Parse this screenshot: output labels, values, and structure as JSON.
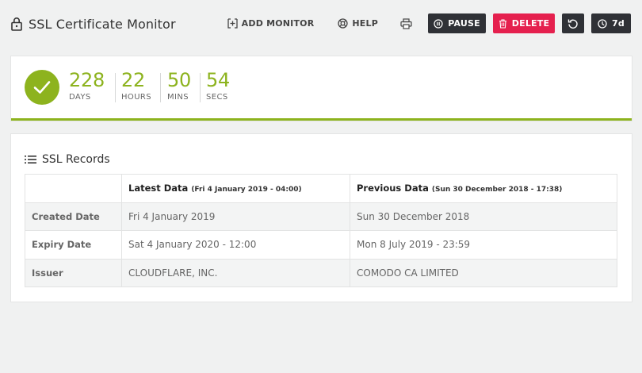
{
  "header": {
    "title": "SSL Certificate Monitor",
    "lock_icon": "lock-icon"
  },
  "toolbar": {
    "add_monitor_label": "ADD MONITOR",
    "help_label": "HELP",
    "pause_label": "PAUSE",
    "delete_label": "DELETE",
    "range_label": "7d",
    "colors": {
      "dark_button": "#2f3136",
      "delete_button": "#e5204e"
    }
  },
  "timer": {
    "status_color": "#8db31e",
    "counters": [
      {
        "value": "228",
        "unit": "DAYS"
      },
      {
        "value": "22",
        "unit": "HOURS"
      },
      {
        "value": "50",
        "unit": "MINS"
      },
      {
        "value": "54",
        "unit": "SECS"
      }
    ]
  },
  "records": {
    "title": "SSL Records",
    "columns": [
      {
        "label": "",
        "sub": ""
      },
      {
        "label": "Latest Data",
        "sub": "(Fri 4 January 2019 - 04:00)"
      },
      {
        "label": "Previous Data",
        "sub": "(Sun 30 December 2018 - 17:38)"
      }
    ],
    "rows": [
      {
        "label": "Created Date",
        "latest": "Fri 4 January 2019",
        "previous": "Sun 30 December 2018"
      },
      {
        "label": "Expiry Date",
        "latest": "Sat 4 January 2020 - 12:00",
        "previous": "Mon 8 July 2019 - 23:59"
      },
      {
        "label": "Issuer",
        "latest": "CLOUDFLARE, INC.",
        "previous": "COMODO CA LIMITED"
      }
    ]
  }
}
